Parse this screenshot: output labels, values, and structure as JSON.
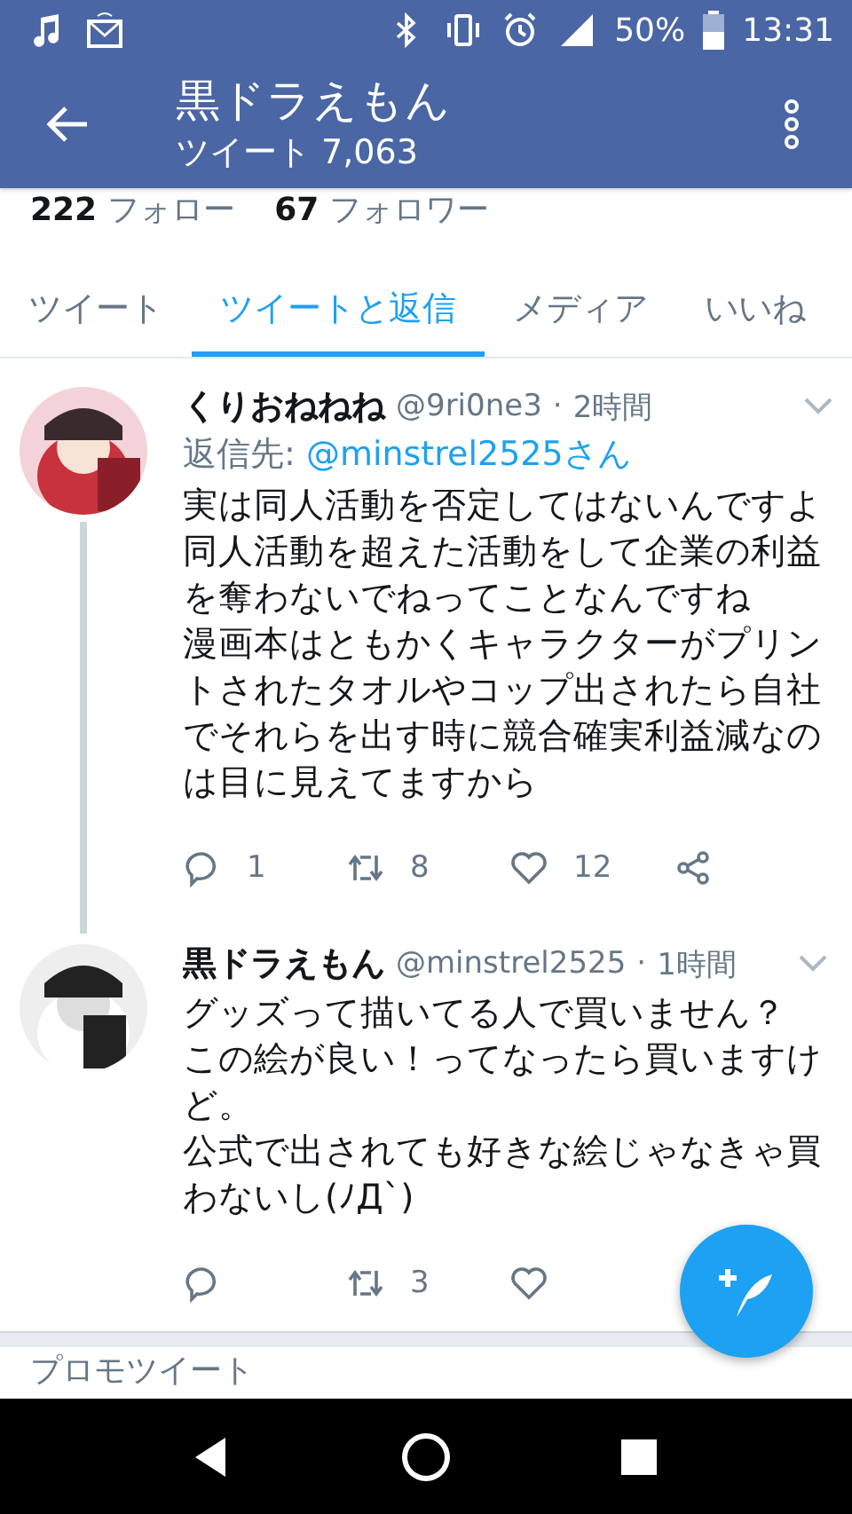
{
  "status_bar": {
    "battery": "50%",
    "time": "13:31"
  },
  "app_bar": {
    "title": "黒ドラえもん",
    "subtitle": "ツイート 7,063"
  },
  "profile_stats": [
    {
      "count": "222",
      "label": "フォロー"
    },
    {
      "count": "67",
      "label": "フォロワー"
    }
  ],
  "tabs": [
    {
      "label": "ツイート",
      "selected": false
    },
    {
      "label": "ツイートと返信",
      "selected": true
    },
    {
      "label": "メディア",
      "selected": false
    },
    {
      "label": "いいね",
      "selected": false
    }
  ],
  "tweets": [
    {
      "name": "くりおねねね",
      "handle": "@9ri0ne3",
      "separator": "·",
      "time": "2時間",
      "reply_prefix": "返信先:",
      "reply_to": "@minstrel2525さん",
      "thread": true,
      "lines": [
        "実は同人活動を否定してはないんですよ",
        "同人活動を超えた活動をして企業の利益",
        "を奪わないでねってことなんですね",
        "漫画本はともかくキャラクターがプリン",
        "トされたタオルやコップ出されたら自社",
        "でそれらを出す時に競合確実利益減なの",
        "は目に見えてますから"
      ],
      "replies": "1",
      "retweets": "8",
      "likes": "12",
      "share": true
    },
    {
      "name": "黒ドラえもん",
      "handle": "@minstrel2525",
      "separator": "·",
      "time": "1時間",
      "thread": false,
      "lines": [
        "グッズって描いてる人で買いません？",
        "この絵が良い！ってなったら買いますけ",
        "ど。",
        "公式で出されても好きな絵じゃなきゃ買",
        "わないし(ﾉД`)"
      ],
      "retweets": "3",
      "share": false
    }
  ],
  "next_section": "プロモツイート"
}
